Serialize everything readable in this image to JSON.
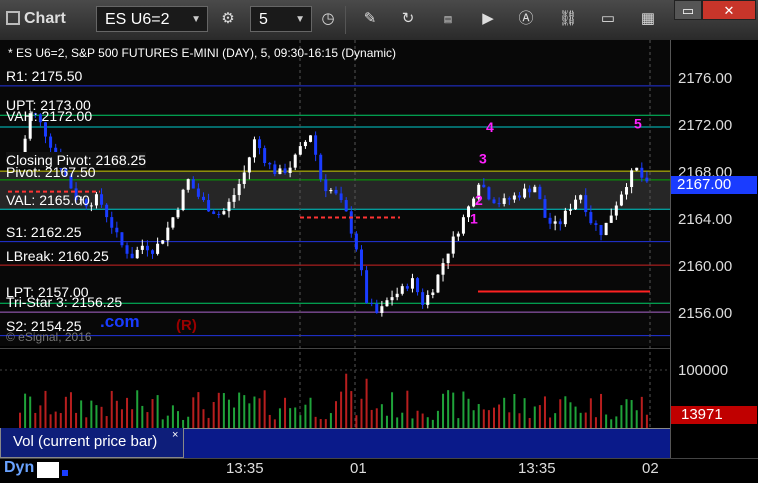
{
  "toolbar": {
    "title": "Chart",
    "symbol": "ES U6=2",
    "interval": "5",
    "icons": [
      "settings-icon",
      "clock-icon",
      "pencil-icon",
      "refresh-icon",
      "get-icon",
      "play-icon",
      "alert-icon",
      "link-icon",
      "comment-icon",
      "template-icon"
    ],
    "window_buttons": [
      "▭",
      "✕"
    ]
  },
  "chart": {
    "header": "* ES U6=2, S&P 500 FUTURES E-MINI (DAY), 5, 09:30-16:15 (Dynamic)",
    "current_price": "2167.00",
    "price_ticks": [
      "2176.00",
      "2172.00",
      "2168.00",
      "2164.00",
      "2160.00",
      "2156.00"
    ],
    "levels": [
      {
        "label": "R1: 2175.50",
        "color": "#2233dd"
      },
      {
        "label": "UPT: 2173.00",
        "color": "#00cc66"
      },
      {
        "label": "VAH: 2172.00",
        "color": "#00cccc"
      },
      {
        "label": "Closing Pivot: 2168.25",
        "color": "#cccc00"
      },
      {
        "label": "Pivot: 2167.50",
        "color": "#00aa00"
      },
      {
        "label": "VAL: 2165.00",
        "color": "#00cccc"
      },
      {
        "label": "S1: 2162.25",
        "color": "#2233dd"
      },
      {
        "label": "LBreak: 2160.25",
        "color": "#cc2222"
      },
      {
        "label": "LPT: 2157.00",
        "color": "#00cc66"
      },
      {
        "label": "Tri-Star 3: 2156.25",
        "color": "#aa66cc"
      },
      {
        "label": "S2: 2154.25",
        "color": "#2233dd"
      }
    ],
    "annotations": [
      "1",
      "2",
      "3",
      "4",
      "5"
    ],
    "watermark_r": "(R)",
    "watermark_com": ".com",
    "copyright": "© eSignal, 2016"
  },
  "volume": {
    "tick": "100000",
    "current_volume": "13971",
    "tab_label": "Vol (current price bar)",
    "close": "×"
  },
  "time_axis": {
    "dyn": "Dyn",
    "labels": [
      "13:35",
      "01",
      "13:35",
      "02"
    ]
  },
  "colors": {
    "up": "#ffffff",
    "down": "#1a3cff",
    "pivot_band": "#2a2a2a",
    "accent_label": "#cc0000"
  }
}
